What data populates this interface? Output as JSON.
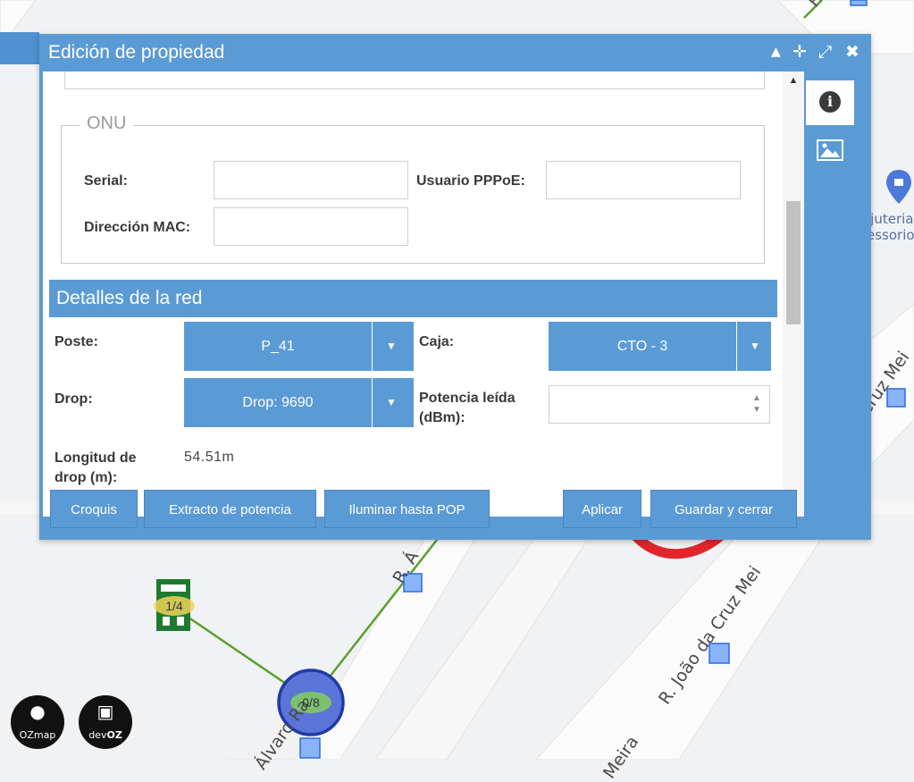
{
  "dialog": {
    "title": "Edición de propiedad",
    "header_icons": [
      "chevron-up-icon",
      "move-icon",
      "expand-icon",
      "close-icon"
    ]
  },
  "onu": {
    "legend": "ONU",
    "serial_label": "Serial:",
    "serial_value": "",
    "pppoe_label": "Usuario PPPoE:",
    "pppoe_value": "",
    "mac_label": "Dirección MAC:",
    "mac_value": ""
  },
  "network": {
    "section_title": "Detalles de la red",
    "pole_label": "Poste:",
    "pole_value": "P_41",
    "box_label": "Caja:",
    "box_value": "CTO - 3",
    "drop_label": "Drop:",
    "drop_value": "Drop: 9690",
    "power_label": "Potencia leída (dBm):",
    "power_value": "",
    "drop_length_label": "Longitud de drop (m):",
    "drop_length_value": "54.51m"
  },
  "buttons": {
    "croquis": "Croquis",
    "power_extract": "Extracto de potencia",
    "illuminate_pop": "Iluminar hasta POP",
    "apply": "Aplicar",
    "save_close": "Guardar y cerrar"
  },
  "side_tabs": [
    "info-icon",
    "image-icon"
  ],
  "map": {
    "streets": [
      "R. João da Cruz Mei",
      "R. João da Cruz Meira",
      "Cruz Mei",
      "R. Á",
      "Álvaro Ra",
      "Meira",
      "R."
    ],
    "poi_text": "ijuteria\nessorio",
    "cluster_building": "1/4",
    "cluster_cto": "0/8"
  },
  "logos": {
    "ozmap": "OZmap",
    "devoz_prefix": "dev",
    "devoz_suffix": "OZ"
  },
  "colors": {
    "accent": "#5b9bd5",
    "fiber_line": "#5aa02c",
    "arrow": "#e0262b"
  }
}
